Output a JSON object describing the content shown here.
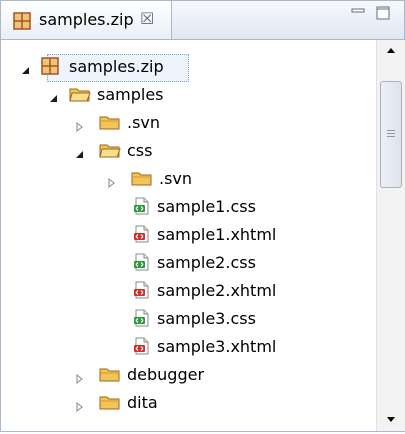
{
  "tab": {
    "title": "samples.zip",
    "close_glyph": "☒"
  },
  "tree": [
    {
      "label": "samples.zip",
      "icon": "archive-icon",
      "twisty": "expanded"
    },
    {
      "label": "samples",
      "icon": "folder-open-icon",
      "twisty": "expanded"
    },
    {
      "label": ".svn",
      "icon": "folder-icon",
      "twisty": "collapsed"
    },
    {
      "label": "css",
      "icon": "folder-open-icon",
      "twisty": "expanded"
    },
    {
      "label": ".svn",
      "icon": "folder-icon",
      "twisty": "collapsed"
    },
    {
      "label": "sample1.css",
      "icon": "css-file-icon",
      "twisty": "none"
    },
    {
      "label": "sample1.xhtml",
      "icon": "xhtml-file-icon",
      "twisty": "none"
    },
    {
      "label": "sample2.css",
      "icon": "css-file-icon",
      "twisty": "none"
    },
    {
      "label": "sample2.xhtml",
      "icon": "xhtml-file-icon",
      "twisty": "none"
    },
    {
      "label": "sample3.css",
      "icon": "css-file-icon",
      "twisty": "none"
    },
    {
      "label": "sample3.xhtml",
      "icon": "xhtml-file-icon",
      "twisty": "none"
    },
    {
      "label": "debugger",
      "icon": "folder-icon",
      "twisty": "collapsed"
    },
    {
      "label": "dita",
      "icon": "folder-icon",
      "twisty": "collapsed"
    }
  ],
  "colors": {
    "folder": "#f5c85b",
    "archive": "#b85a2a",
    "css_badge": "#2f9a3a",
    "xhtml_badge": "#d22f2f"
  }
}
